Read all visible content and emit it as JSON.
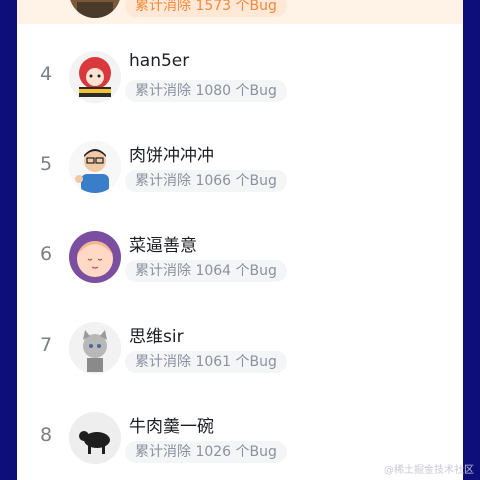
{
  "leaderboard": {
    "items": [
      {
        "rank": "",
        "name": "",
        "stat": "累计消除 1573 个Bug"
      },
      {
        "rank": "4",
        "name": "han5er",
        "stat": "累计消除 1080 个Bug"
      },
      {
        "rank": "5",
        "name": "肉饼冲冲冲",
        "stat": "累计消除 1066 个Bug"
      },
      {
        "rank": "6",
        "name": "菜逼善意",
        "stat": "累计消除 1064 个Bug"
      },
      {
        "rank": "7",
        "name": "思维sir",
        "stat": "累计消除 1061 个Bug"
      },
      {
        "rank": "8",
        "name": "牛肉羹一碗",
        "stat": "累计消除 1026 个Bug"
      }
    ]
  },
  "watermark": "@稀土掘金技术社区"
}
